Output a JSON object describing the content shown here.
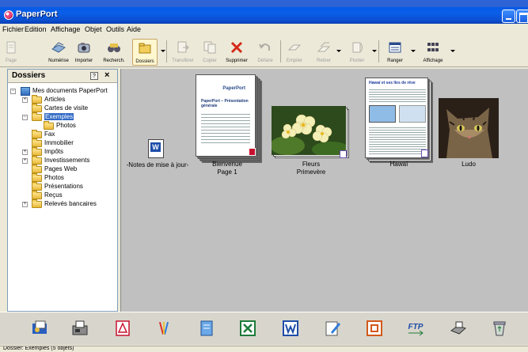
{
  "window": {
    "title": "PaperPort"
  },
  "menu": [
    "Fichier",
    "Edition",
    "Affichage",
    "Objet",
    "Outils",
    "Aide"
  ],
  "toolbar": {
    "page": "Page",
    "numerise": "Numérise",
    "importer": "Importer",
    "recherche": "Recherch.",
    "dossiers": "Dossiers",
    "transferer": "Transférer",
    "copier": "Copier",
    "supprimer": "Supprimer",
    "defaire": "Défaire",
    "empiler": "Empiler",
    "retirer": "Retirer",
    "pivoter": "Pivoter",
    "ranger": "Ranger",
    "affichage": "Affichage"
  },
  "sidebar": {
    "title": "Dossiers",
    "help": "?",
    "close": "×",
    "tree": [
      "Mes documents PaperPort",
      "Articles",
      "Cartes de visite",
      "Exemples",
      "Photos",
      "Fax",
      "Immobilier",
      "Impôts",
      "Investissements",
      "Pages Web",
      "Photos",
      "Présentations",
      "Reçus",
      "Relevés bancaires"
    ]
  },
  "items": {
    "notes": "-Notes de mise à jour-",
    "bienvenue_1": "Bienvenue",
    "bienvenue_2": "Page 1",
    "fleurs_1": "Fleurs",
    "fleurs_2": "Primevère",
    "hawai": "Hawaï",
    "ludo": "Ludo",
    "paperport_logo": "PaperPort",
    "pp_doc_title": "PaperPort – Présentation générale",
    "hawai_doc_title": "Hawaï et ses îles de rêve",
    "word_badge": "W"
  },
  "bottom_apps": [
    "outlook-icon",
    "fax-icon",
    "pdf-icon",
    "paint-icon",
    "notepad-icon",
    "excel-icon",
    "word-icon",
    "wordpad-icon",
    "powerpoint-icon",
    "ftp-icon",
    "scanner-icon",
    "recycle-icon"
  ],
  "bottom_labels": {
    "ftp": "FTP"
  },
  "status": {
    "text": "Dossier: Exemples (5 objets)"
  },
  "colors": {
    "title_blue": "#0a5fe8",
    "content_bg": "#c0c0c0",
    "selection": "#316ac5"
  }
}
